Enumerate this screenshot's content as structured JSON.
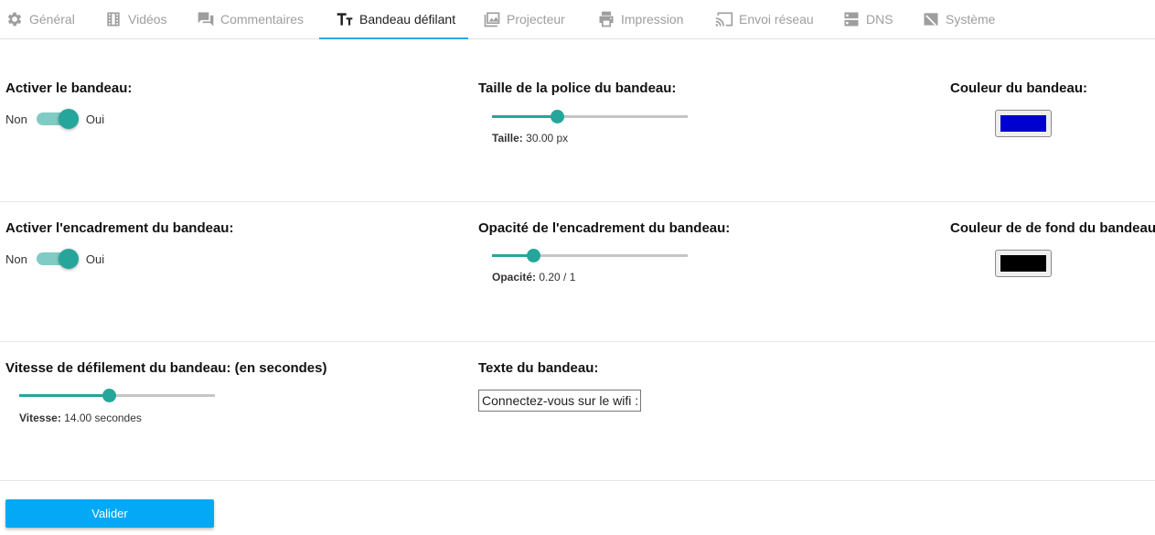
{
  "tabs": [
    {
      "label": "Général",
      "icon": "gear-icon",
      "active": false
    },
    {
      "label": "Vidéos",
      "icon": "film-icon",
      "active": false
    },
    {
      "label": "Commentaires",
      "icon": "comments-icon",
      "active": false
    },
    {
      "label": "Bandeau défilant",
      "icon": "text-size-icon",
      "active": true
    },
    {
      "label": "Projecteur",
      "icon": "image-icon",
      "active": false
    },
    {
      "label": "Impression",
      "icon": "printer-icon",
      "active": false
    },
    {
      "label": "Envoi réseau",
      "icon": "cast-icon",
      "active": false
    },
    {
      "label": "DNS",
      "icon": "dns-icon",
      "active": false
    },
    {
      "label": "Système",
      "icon": "no-system-icon",
      "active": false
    }
  ],
  "banner": {
    "enable": {
      "label": "Activer le bandeau:",
      "off": "Non",
      "on": "Oui",
      "value": true
    },
    "font_size": {
      "label": "Taille de la police du bandeau:",
      "caption_key": "Taille:",
      "caption_value": "30.00 px",
      "fraction": 0.33
    },
    "color": {
      "label": "Couleur du bandeau:",
      "value": "#0000d0"
    },
    "frame": {
      "label": "Activer l'encadrement du bandeau:",
      "off": "Non",
      "on": "Oui",
      "value": true
    },
    "frame_opacity": {
      "label": "Opacité de l'encadrement du bandeau:",
      "caption_key": "Opacité:",
      "caption_value": "0.20 / 1",
      "fraction": 0.21
    },
    "bg_color": {
      "label": "Couleur de de fond du bandeau:",
      "value": "#000000"
    },
    "speed": {
      "label": "Vitesse de défilement du bandeau: (en secondes)",
      "caption_key": "Vitesse:",
      "caption_value": "14.00 secondes",
      "fraction": 0.46
    },
    "text": {
      "label": "Texte du bandeau:",
      "value": "Connectez-vous sur le wifi : "
    }
  },
  "submit_label": "Valider",
  "colors": {
    "accent": "#26a69a",
    "accent_light": "#80cbc4",
    "tab_indicator": "#29a8e6",
    "button": "#03a9f4"
  }
}
